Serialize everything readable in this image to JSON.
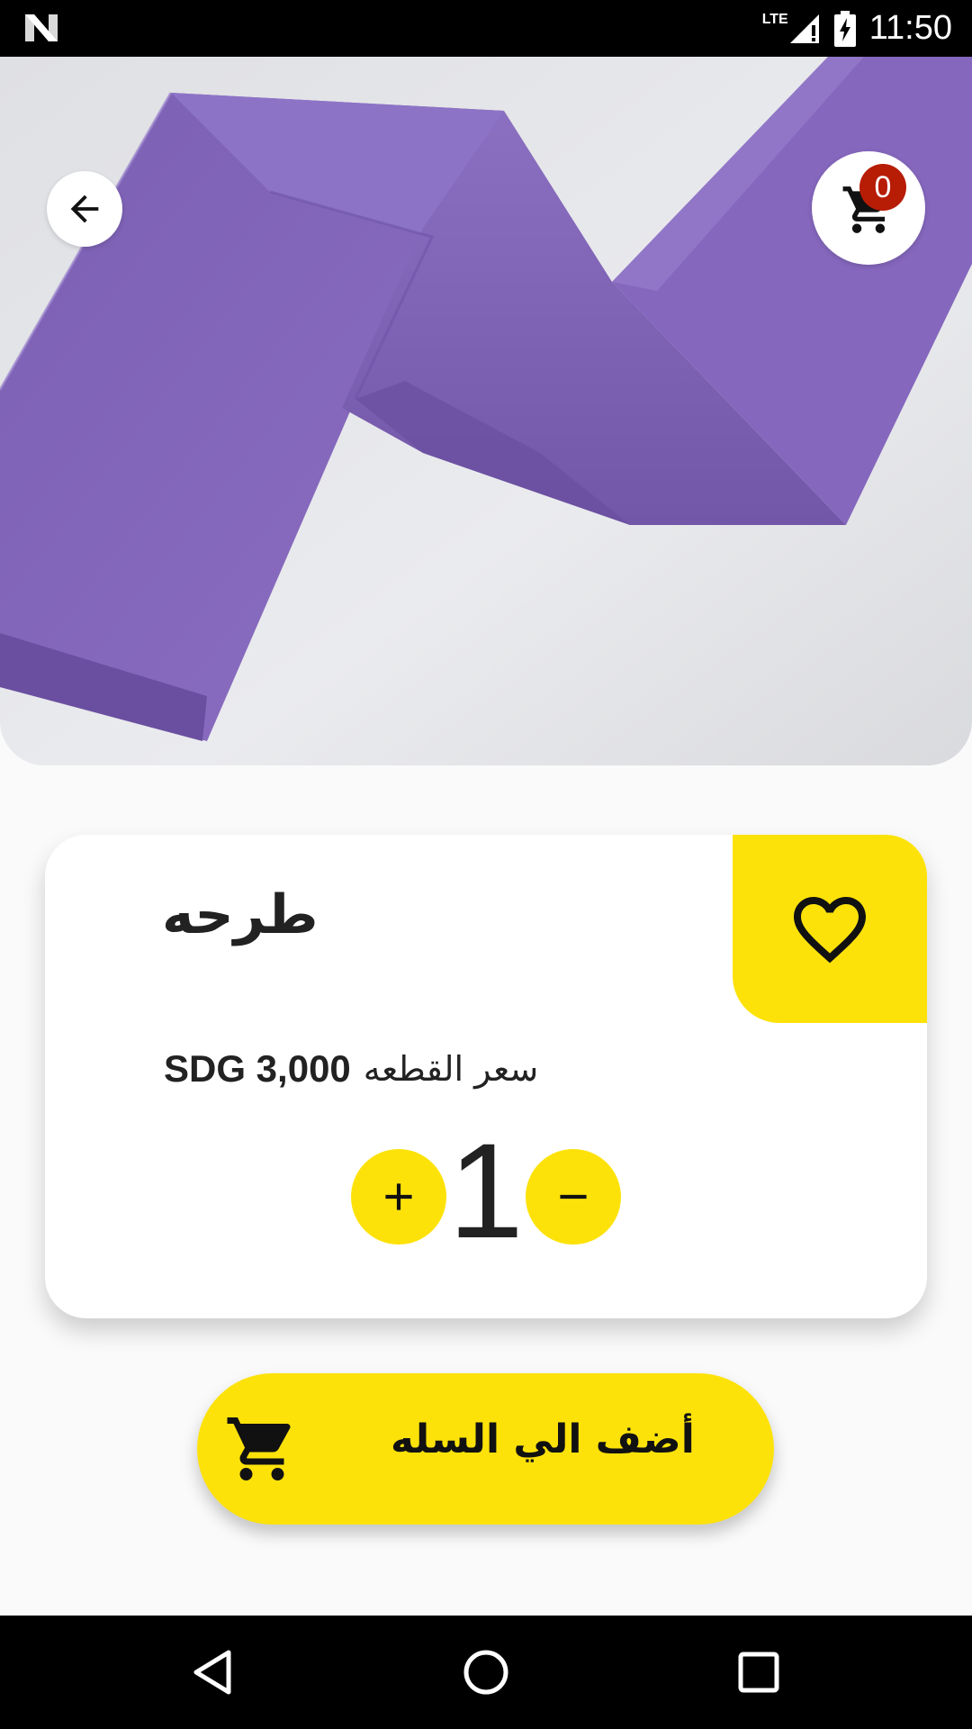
{
  "status_bar": {
    "time": "11:50",
    "network": "LTE"
  },
  "product": {
    "title": "طرحه",
    "price_value": "SDG 3,000",
    "price_label": "سعر القطعه",
    "quantity": "1"
  },
  "cart": {
    "count": "0"
  },
  "actions": {
    "add_to_cart_label": "أضف الي السله"
  },
  "colors": {
    "accent": "#fde20a",
    "badge": "#b71c05",
    "fabric": "#8466b8"
  },
  "icons": [
    "back-arrow-icon",
    "cart-icon",
    "heart-icon",
    "plus-icon",
    "minus-icon",
    "nav-back-icon",
    "nav-home-icon",
    "nav-recents-icon"
  ]
}
